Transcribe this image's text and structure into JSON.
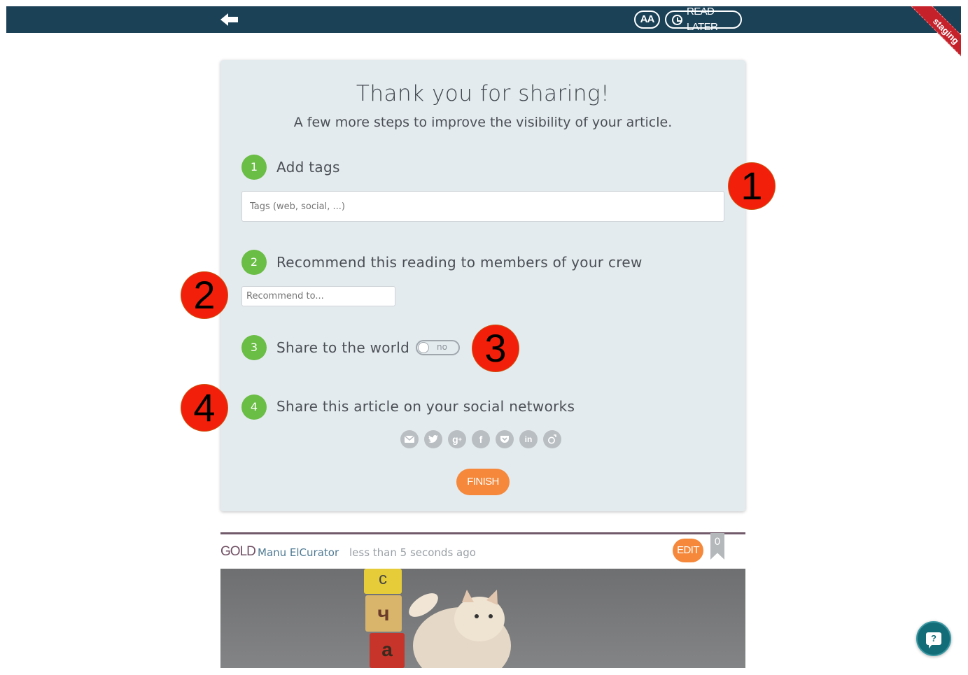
{
  "topbar": {
    "font_button_label": "AA",
    "read_later_label": "READ LATER",
    "ribbon_label": "staging",
    "color": "#1b4157"
  },
  "card": {
    "title": "Thank you for sharing!",
    "subtitle": "A few more steps to improve the visibility of your article.",
    "steps": [
      {
        "number": "1",
        "label": "Add tags"
      },
      {
        "number": "2",
        "label": "Recommend this reading to members of your crew"
      },
      {
        "number": "3",
        "label": "Share to the world"
      },
      {
        "number": "4",
        "label": "Share this article on your social networks"
      }
    ],
    "tags_placeholder": "Tags (web, social, ...)",
    "recommend_placeholder": "Recommend to...",
    "share_toggle_text": "no",
    "socials": [
      "email-icon",
      "twitter-icon",
      "google-plus-icon",
      "facebook-icon",
      "pocket-icon",
      "linkedin-icon",
      "viadeo-icon"
    ],
    "finish_label": "FINISH"
  },
  "annotations": [
    "1",
    "2",
    "3",
    "4"
  ],
  "article": {
    "tag": "GOLD",
    "author": "Manu ElCurator",
    "time": "less than 5 seconds ago",
    "edit_label": "EDIT",
    "bookmark_count": "0"
  },
  "colors": {
    "accent_orange": "#f5883a",
    "step_green": "#6abd45",
    "annotation_red": "#f2200a"
  }
}
